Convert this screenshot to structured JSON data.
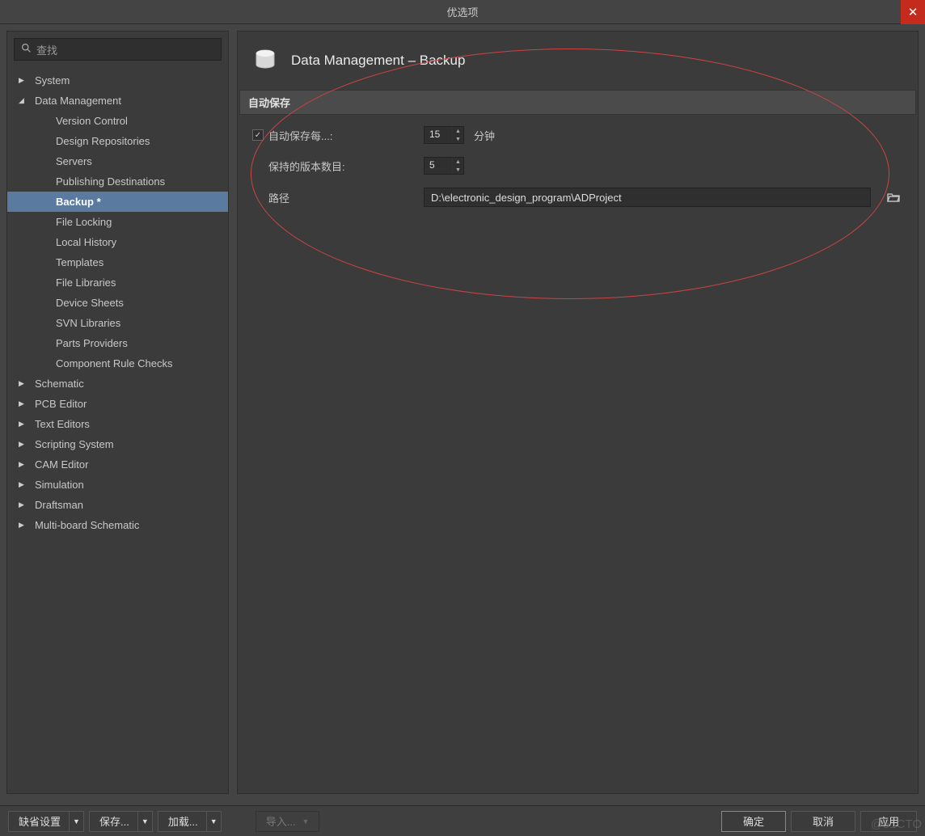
{
  "title": "优选项",
  "search_placeholder": "查找",
  "tree": {
    "items": [
      {
        "label": "System",
        "state": "collapsed",
        "depth": 0
      },
      {
        "label": "Data Management",
        "state": "expanded",
        "depth": 0
      },
      {
        "label": "Version Control",
        "state": "child",
        "depth": 1
      },
      {
        "label": "Design Repositories",
        "state": "child",
        "depth": 1
      },
      {
        "label": "Servers",
        "state": "child",
        "depth": 1
      },
      {
        "label": "Publishing Destinations",
        "state": "child",
        "depth": 1
      },
      {
        "label": "Backup *",
        "state": "child",
        "depth": 1,
        "selected": true
      },
      {
        "label": "File Locking",
        "state": "child",
        "depth": 1
      },
      {
        "label": "Local History",
        "state": "child",
        "depth": 1
      },
      {
        "label": "Templates",
        "state": "child",
        "depth": 1
      },
      {
        "label": "File Libraries",
        "state": "child",
        "depth": 1
      },
      {
        "label": "Device Sheets",
        "state": "child",
        "depth": 1
      },
      {
        "label": "SVN Libraries",
        "state": "child",
        "depth": 1
      },
      {
        "label": "Parts Providers",
        "state": "child",
        "depth": 1
      },
      {
        "label": "Component Rule Checks",
        "state": "child",
        "depth": 1
      },
      {
        "label": "Schematic",
        "state": "collapsed",
        "depth": 0
      },
      {
        "label": "PCB Editor",
        "state": "collapsed",
        "depth": 0
      },
      {
        "label": "Text Editors",
        "state": "collapsed",
        "depth": 0
      },
      {
        "label": "Scripting System",
        "state": "collapsed",
        "depth": 0
      },
      {
        "label": "CAM Editor",
        "state": "collapsed",
        "depth": 0
      },
      {
        "label": "Simulation",
        "state": "collapsed",
        "depth": 0
      },
      {
        "label": "Draftsman",
        "state": "collapsed",
        "depth": 0
      },
      {
        "label": "Multi-board Schematic",
        "state": "collapsed",
        "depth": 0
      }
    ]
  },
  "content": {
    "title": "Data Management – Backup",
    "section": "自动保存",
    "autosave_label": "自动保存每...:",
    "autosave_checked": true,
    "autosave_value": "15",
    "autosave_unit": "分钟",
    "versions_label": "保持的版本数目:",
    "versions_value": "5",
    "path_label": "路径",
    "path_value": "D:\\electronic_design_program\\ADProject"
  },
  "footer": {
    "defaults": "缺省设置",
    "save": "保存...",
    "load": "加载...",
    "import": "导入...",
    "ok": "确定",
    "cancel": "取消",
    "apply": "应用"
  },
  "watermark": "@51CTO"
}
